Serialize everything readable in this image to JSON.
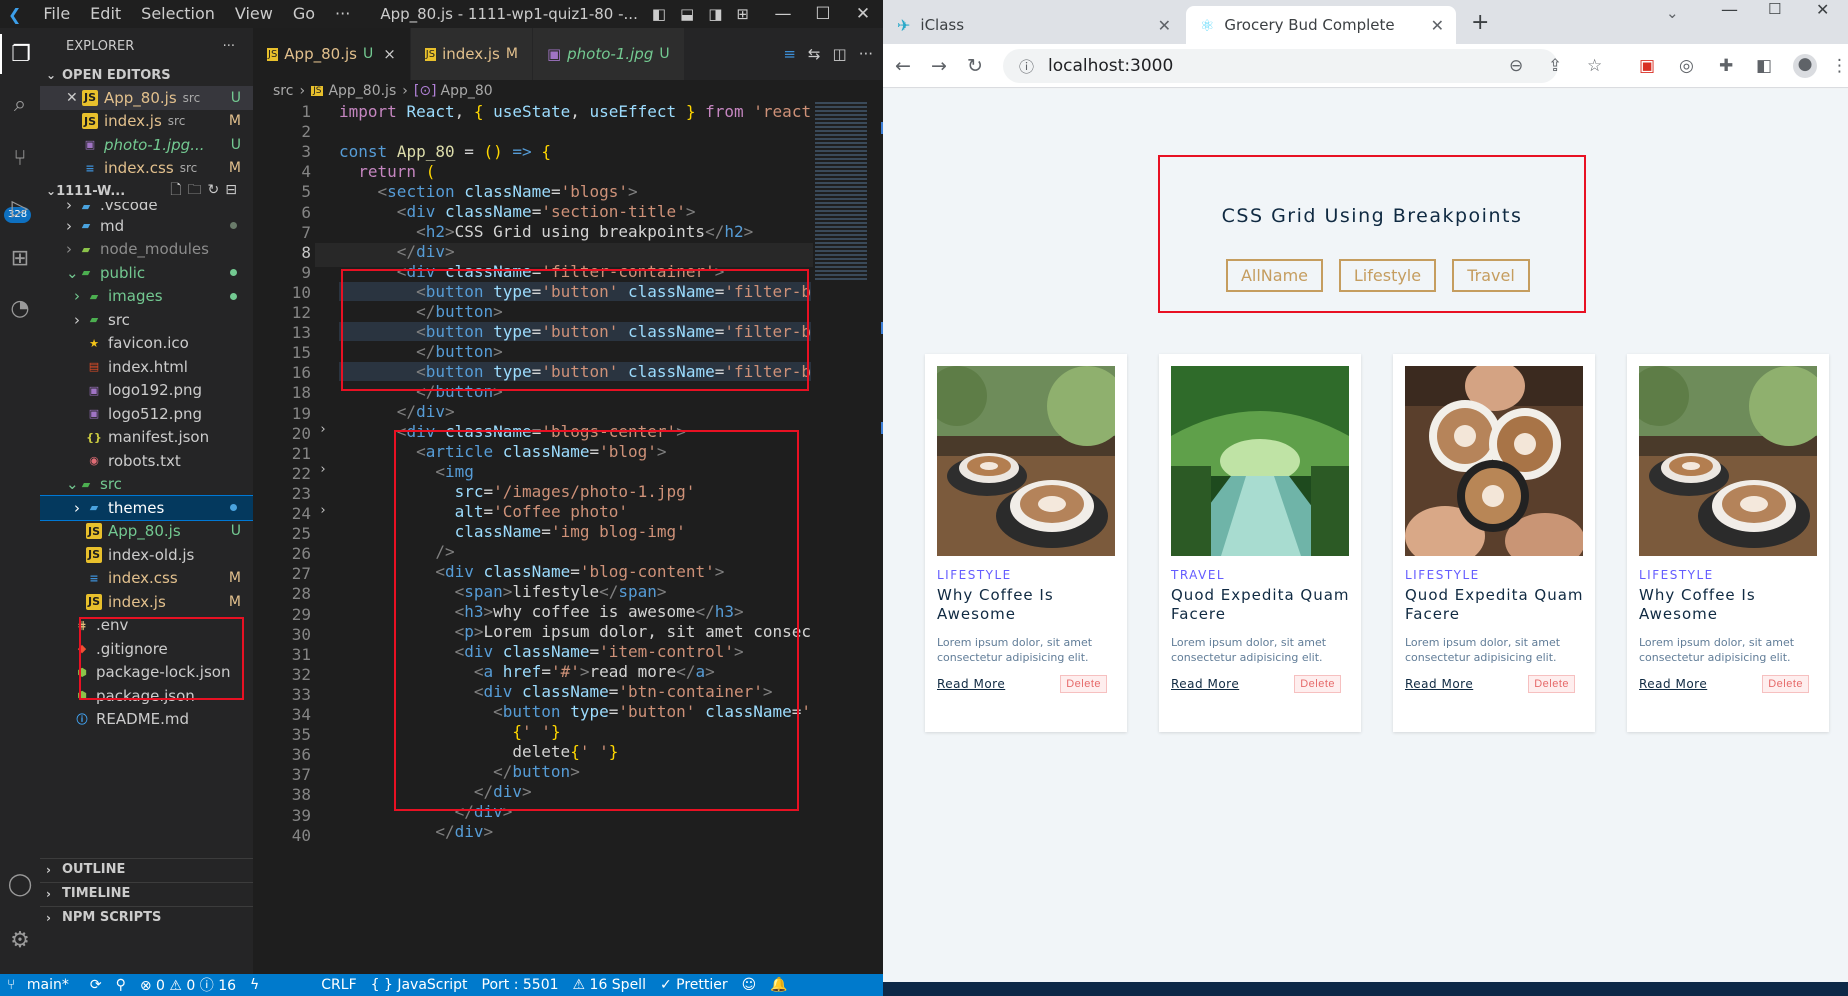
{
  "vscode": {
    "menu": [
      "File",
      "Edit",
      "Selection",
      "View",
      "Go",
      "···"
    ],
    "window_title": "App_80.js - 1111-wp1-quiz1-80 -...",
    "activity_badge": "328",
    "explorer_title": "EXPLORER",
    "open_editors_label": "OPEN EDITORS",
    "open_editors": [
      {
        "name": "App_80.js",
        "sub": "src",
        "status": "U",
        "icon": "js-icon",
        "close": true
      },
      {
        "name": "index.js",
        "sub": "src",
        "status": "M",
        "icon": "js-icon"
      },
      {
        "name": "photo-1.jpg...",
        "sub": "",
        "status": "U",
        "icon": "image-icon"
      },
      {
        "name": "index.css",
        "sub": "src",
        "status": "M",
        "icon": "css-icon"
      }
    ],
    "workspace_label": "1111-W...",
    "tree": [
      {
        "name": ".vscode",
        "icon": "folder-icon"
      },
      {
        "name": "md",
        "icon": "folder-icon"
      },
      {
        "name": "node_modules",
        "icon": "folder-icon"
      },
      {
        "name": "public",
        "icon": "folder-icon"
      },
      {
        "name": "images",
        "icon": "folder-icon"
      },
      {
        "name": "src",
        "icon": "folder-icon"
      },
      {
        "name": "favicon.ico",
        "icon": "star-icon"
      },
      {
        "name": "index.html",
        "icon": "html-icon"
      },
      {
        "name": "logo192.png",
        "icon": "image-icon"
      },
      {
        "name": "logo512.png",
        "icon": "image-icon"
      },
      {
        "name": "manifest.json",
        "icon": "json-icon"
      },
      {
        "name": "robots.txt",
        "icon": "robot-icon"
      },
      {
        "name": "src",
        "icon": "folder-icon"
      },
      {
        "name": "themes",
        "icon": "folder-icon"
      },
      {
        "name": "App_80.js",
        "icon": "js-icon",
        "status": "U"
      },
      {
        "name": "index-old.js",
        "icon": "js-icon"
      },
      {
        "name": "index.css",
        "icon": "css-icon",
        "status": "M"
      },
      {
        "name": "index.js",
        "icon": "js-icon",
        "status": "M"
      },
      {
        "name": ".env",
        "icon": "env-icon"
      },
      {
        "name": ".gitignore",
        "icon": "git-icon"
      },
      {
        "name": "package-lock.json",
        "icon": "node-icon"
      },
      {
        "name": "package.json",
        "icon": "node-icon"
      },
      {
        "name": "README.md",
        "icon": "info-icon"
      }
    ],
    "bottom_sections": [
      "OUTLINE",
      "TIMELINE",
      "NPM SCRIPTS"
    ],
    "tabs": [
      {
        "label": "App_80.js",
        "status": "U",
        "close": "×",
        "active": true
      },
      {
        "label": "index.js",
        "status": "M"
      },
      {
        "label": "photo-1.jpg",
        "status": "U"
      }
    ],
    "breadcrumb": [
      "src",
      "App_80.js",
      "App_80"
    ],
    "status_bar": {
      "branch": "main*",
      "problems": "⊗ 0 ⚠ 0 ⓘ 16",
      "eol": "CRLF",
      "language": "{ } JavaScript",
      "port": "Port : 5501",
      "spell": "⚠ 16 Spell",
      "prettier": "✓ Prettier"
    },
    "line_numbers": [
      "1",
      "2",
      "3",
      "4",
      "5",
      "6",
      "7",
      "8",
      "9",
      "10",
      "12",
      "13",
      "15",
      "16",
      "18",
      "19",
      "20",
      "21",
      "22",
      "23",
      "24",
      "25",
      "26",
      "27",
      "28",
      "29",
      "30",
      "31",
      "32",
      "33",
      "34",
      "35",
      "36",
      "37",
      "38",
      "39",
      "40"
    ]
  },
  "chrome": {
    "tabs": [
      {
        "title": "iClass",
        "active": false
      },
      {
        "title": "Grocery Bud Complete",
        "active": true
      }
    ],
    "url": "localhost:3000",
    "page": {
      "title": "CSS Grid Using Breakpoints",
      "filters": [
        "AllName",
        "Lifestyle",
        "Travel"
      ],
      "cards": [
        {
          "category": "LIFESTYLE",
          "title": "Why Coffee Is Awesome",
          "text": "Lorem ipsum dolor, sit amet consectetur adipisicing elit.",
          "read_more": "Read More",
          "delete": "Delete",
          "image": "coffee-cups"
        },
        {
          "category": "TRAVEL",
          "title": "Quod Expedita Quam Facere",
          "text": "Lorem ipsum dolor, sit amet consectetur adipisicing elit.",
          "read_more": "Read More",
          "delete": "Delete",
          "image": "river-forest"
        },
        {
          "category": "LIFESTYLE",
          "title": "Quod Expedita Quam Facere",
          "text": "Lorem ipsum dolor, sit amet consectetur adipisicing elit.",
          "read_more": "Read More",
          "delete": "Delete",
          "image": "hands-coffee"
        },
        {
          "category": "LIFESTYLE",
          "title": "Why Coffee Is Awesome",
          "text": "Lorem ipsum dolor, sit amet consectetur adipisicing elit.",
          "read_more": "Read More",
          "delete": "Delete",
          "image": "coffee-cups"
        }
      ]
    }
  },
  "colors": {
    "vscode_accent": "#007acc",
    "highlight_box": "#e81123",
    "filter_btn": "#c59d5f",
    "category": "#645cff"
  }
}
